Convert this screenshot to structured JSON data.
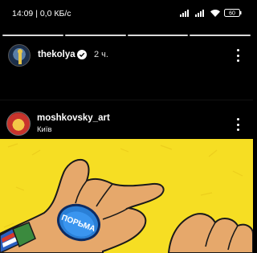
{
  "status_bar": {
    "time_speed": "14:09 | 0,0 КБ/с",
    "battery_level": "60"
  },
  "story": {
    "username": "thekolya",
    "time_ago": "2 ч."
  },
  "post": {
    "username": "moshkovsky_art",
    "location": "Київ",
    "badge_text": "ПОРЬМА"
  },
  "colors": {
    "background": "#000000",
    "image_yellow": "#f6de23",
    "hand_tan": "#e3a86b",
    "button_blue": "#2a7fd6"
  }
}
